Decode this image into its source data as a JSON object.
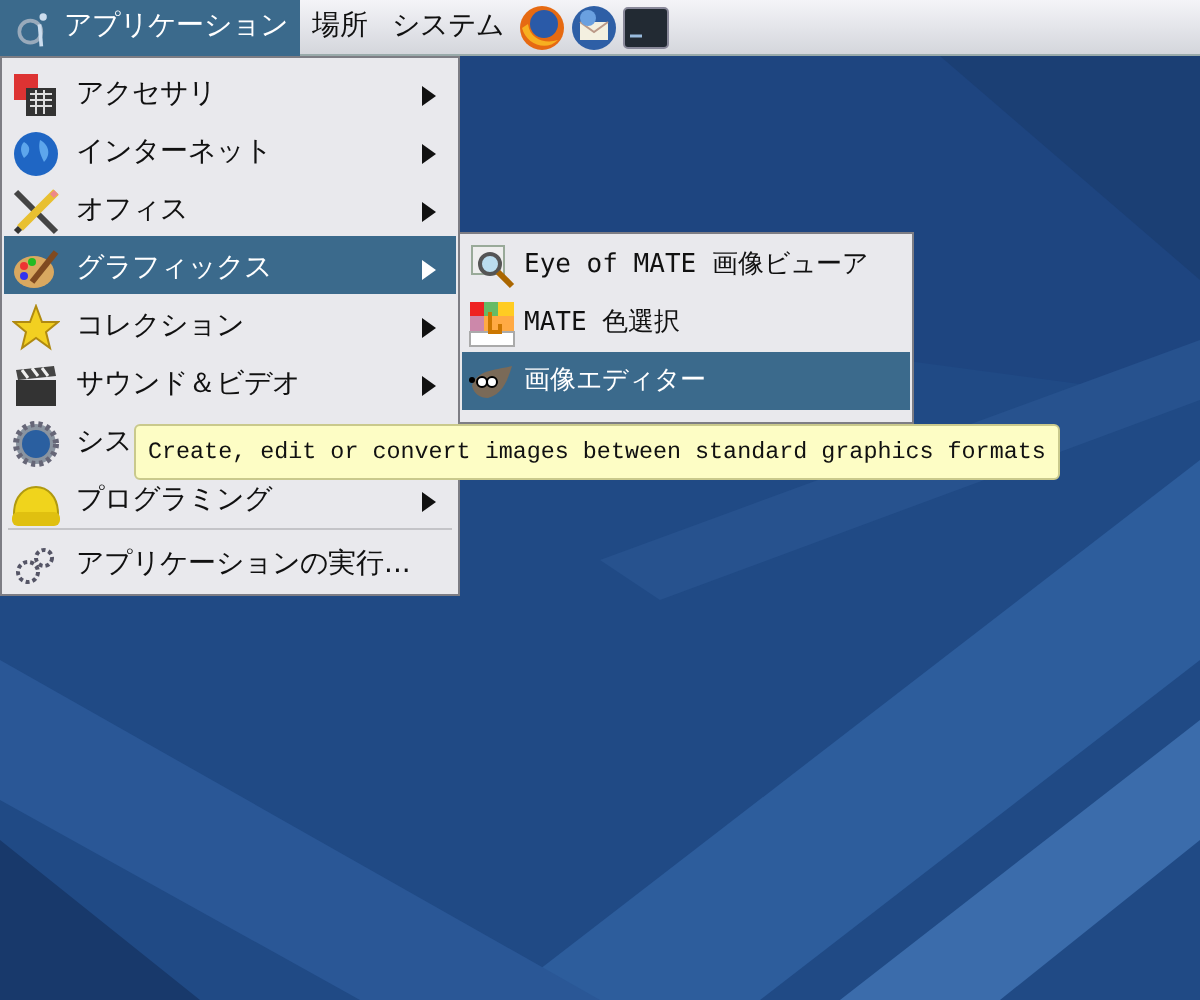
{
  "panel": {
    "menus": [
      {
        "label": "アプリケーション",
        "selected": true
      },
      {
        "label": "場所",
        "selected": false
      },
      {
        "label": "システム",
        "selected": false
      }
    ]
  },
  "menu": {
    "items": [
      {
        "kind": "item",
        "label": "アクセサリ",
        "submenu": true,
        "selected": false
      },
      {
        "kind": "item",
        "label": "インターネット",
        "submenu": true,
        "selected": false
      },
      {
        "kind": "item",
        "label": "オフィス",
        "submenu": true,
        "selected": false
      },
      {
        "kind": "item",
        "label": "グラフィックス",
        "submenu": true,
        "selected": true
      },
      {
        "kind": "item",
        "label": "コレクション",
        "submenu": true,
        "selected": false
      },
      {
        "kind": "item",
        "label": "サウンド＆ビデオ",
        "submenu": true,
        "selected": false
      },
      {
        "kind": "item",
        "label": "シス",
        "submenu": false,
        "selected": false
      },
      {
        "kind": "item",
        "label": "プログラミング",
        "submenu": true,
        "selected": false
      },
      {
        "kind": "separator"
      },
      {
        "kind": "item",
        "label": "アプリケーションの実行...",
        "submenu": false,
        "selected": false
      }
    ]
  },
  "submenu": {
    "items": [
      {
        "label": "Eye of MATE 画像ビューア",
        "selected": false
      },
      {
        "label": "MATE 色選択",
        "selected": false
      },
      {
        "label": "画像エディター",
        "selected": true
      }
    ]
  },
  "tooltip": {
    "text": "Create, edit or convert images between standard graphics formats"
  }
}
